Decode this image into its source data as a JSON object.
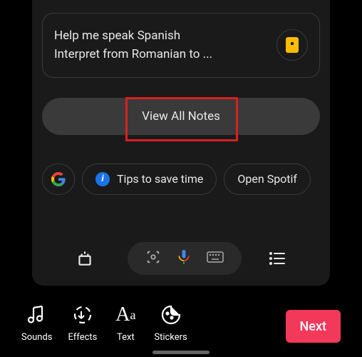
{
  "note": {
    "line1": "Help me speak Spanish",
    "line2": "Interpret from Romanian to ..."
  },
  "viewAll": {
    "label": "View All Notes"
  },
  "chips": {
    "tips": "Tips to save time",
    "spotify": "Open Spotif"
  },
  "toolbar": {
    "sounds": "Sounds",
    "effects": "Effects",
    "text": "Text",
    "stickers": "Stickers",
    "next": "Next"
  }
}
